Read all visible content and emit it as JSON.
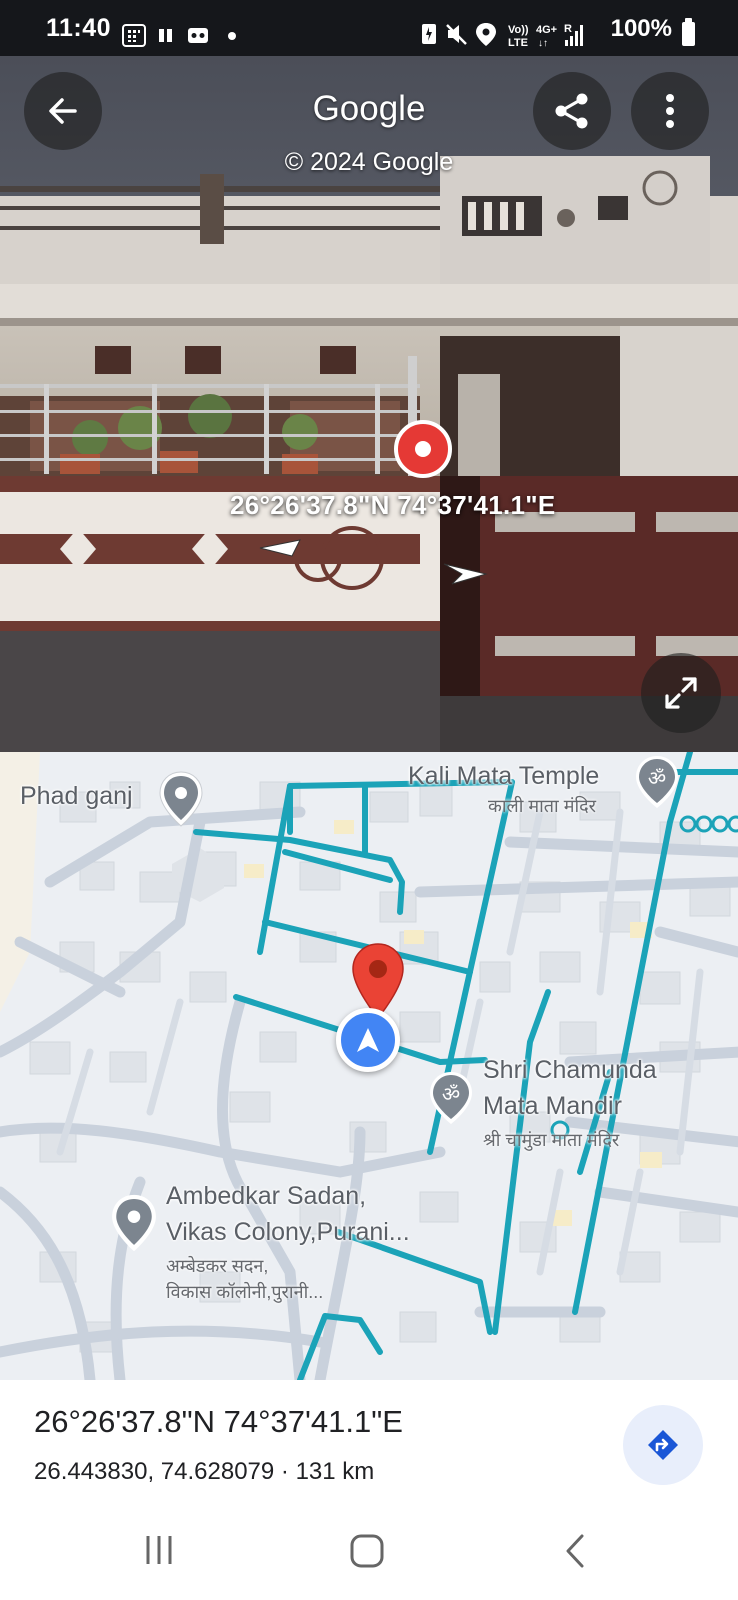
{
  "status_bar": {
    "time": "11:40",
    "battery": "100%",
    "network_volte": "Vo)) LTE",
    "network_4g": "4G+",
    "signal_r": "R"
  },
  "street_view": {
    "title": "Google",
    "copyright": "© 2024 Google",
    "coordinates": "26°26'37.8\"N 74°37'41.1\"E"
  },
  "map": {
    "places": [
      {
        "name": "Phad ganj"
      },
      {
        "name": "Kali Mata Temple",
        "local_name": "काली माता मंदिर"
      },
      {
        "name_line1": "Shri Chamunda",
        "name_line2": "Mata Mandir",
        "local_name": "श्री चामुंडा माता मंदिर"
      },
      {
        "name_line1": "Ambedkar Sadan,",
        "name_line2": "Vikas Colony,Purani...",
        "local_line1": "अम्बेडकर सदन,",
        "local_line2": "विकास कॉलोनी,पुरानी..."
      }
    ]
  },
  "panel": {
    "title": "26°26'37.8\"N 74°37'41.1\"E",
    "subtitle": "26.443830, 74.628079 · 131 km"
  },
  "colors": {
    "route": "#1ba3b8",
    "pin": "#ea4335",
    "location_dot": "#4285f4",
    "direction_icon": "#1a56d6"
  },
  "icons": {
    "back": "arrow-left-icon",
    "share": "share-icon",
    "more": "more-vert-icon",
    "expand": "expand-icon",
    "directions": "directions-icon"
  }
}
